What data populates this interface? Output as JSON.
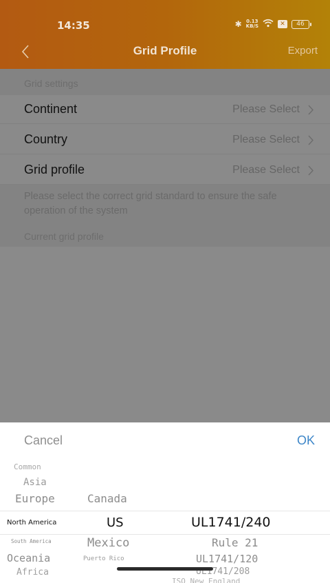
{
  "status_bar": {
    "time": "14:35",
    "speed_value": "0.13",
    "speed_unit": "KB/S",
    "battery": "46"
  },
  "nav": {
    "title": "Grid Profile",
    "export_label": "Export"
  },
  "settings": {
    "section_label": "Grid settings",
    "rows": [
      {
        "label": "Continent",
        "value": "Please Select"
      },
      {
        "label": "Country",
        "value": "Please Select"
      },
      {
        "label": "Grid profile",
        "value": "Please Select"
      }
    ],
    "hint": "Please select the correct grid standard to ensure the safe operation of the system",
    "current_label": "Current grid profile"
  },
  "picker": {
    "cancel_label": "Cancel",
    "ok_label": "OK",
    "continents": [
      "Common",
      "Asia",
      "Europe",
      "North America",
      "South America",
      "Oceania",
      "Africa"
    ],
    "countries": [
      "Canada",
      "US",
      "Mexico",
      "Puerto Rico"
    ],
    "profiles": [
      "UL1741/240",
      "Rule 21",
      "UL1741/120",
      "UL1741/208",
      "ISO New England"
    ],
    "selected": {
      "continent": "North America",
      "country": "US",
      "profile": "UL1741/240"
    }
  },
  "colors": {
    "header_start": "#b35a12",
    "header_end": "#b38208",
    "ok_blue": "#3d86c8"
  }
}
